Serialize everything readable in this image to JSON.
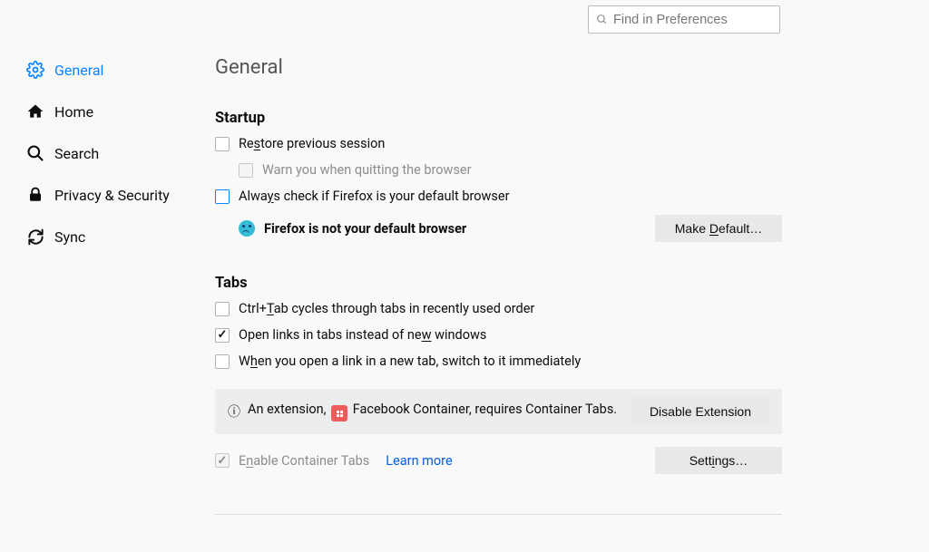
{
  "search": {
    "placeholder": "Find in Preferences"
  },
  "sidebar": {
    "items": [
      {
        "label": "General"
      },
      {
        "label": "Home"
      },
      {
        "label": "Search"
      },
      {
        "label": "Privacy & Security"
      },
      {
        "label": "Sync"
      }
    ]
  },
  "main": {
    "title": "General",
    "startup": {
      "heading": "Startup",
      "restore_pre": "Re",
      "restore_accel": "s",
      "restore_post": "tore previous session",
      "warn": "Warn you when quitting the browser",
      "always_pre": "Alwa",
      "always_accel": "y",
      "always_post": "s check if Firefox is your default browser",
      "not_default": "Firefox is not your default browser",
      "make_default_pre": "Make ",
      "make_default_accel": "D",
      "make_default_post": "efault…"
    },
    "tabs": {
      "heading": "Tabs",
      "ctrltab_pre": "Ctrl+",
      "ctrltab_accel": "T",
      "ctrltab_post": "ab cycles through tabs in recently used order",
      "open_pre": "Open links in tabs instead of ne",
      "open_accel": "w",
      "open_post": " windows",
      "switch_pre": "W",
      "switch_accel": "h",
      "switch_post": "en you open a link in a new tab, switch to it immediately",
      "ext_notice_pre": "An extension, ",
      "ext_name": "Facebook Container",
      "ext_notice_post": ", requires Container Tabs.",
      "disable_ext": "Disable Extension",
      "enable_container_pre": "E",
      "enable_container_accel": "n",
      "enable_container_post": "able Container Tabs",
      "learn_more": "Learn more",
      "settings_pre": "Sett",
      "settings_accel": "i",
      "settings_post": "ngs…"
    }
  }
}
